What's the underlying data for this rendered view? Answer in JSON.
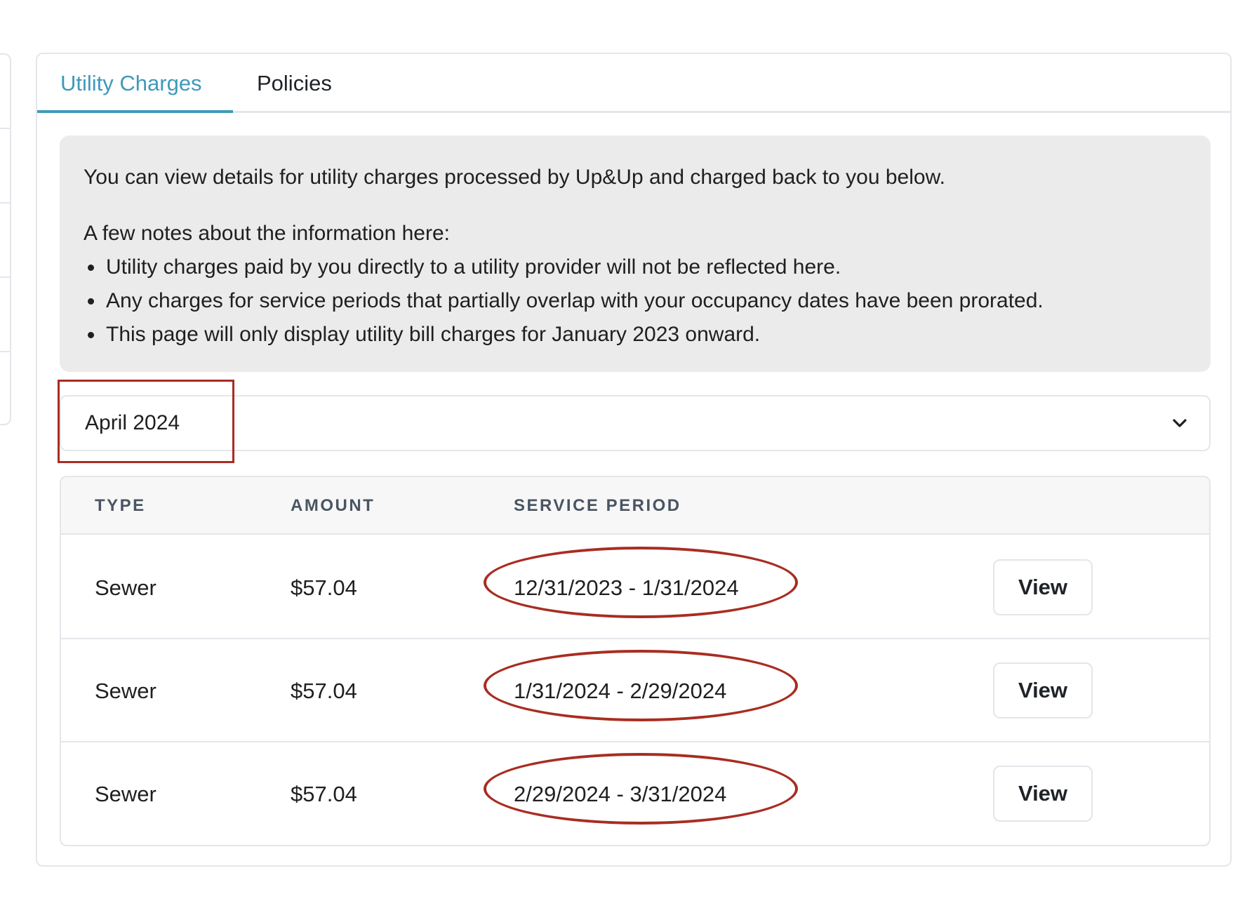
{
  "tabs": [
    {
      "label": "Utility Charges",
      "active": true
    },
    {
      "label": "Policies",
      "active": false
    }
  ],
  "info": {
    "intro": "You can view details for utility charges processed by Up&Up and charged back to you below.",
    "notes_heading": "A few notes about the information here:",
    "notes": [
      "Utility charges paid by you directly to a utility provider will not be reflected here.",
      "Any charges for service periods that partially overlap with your occupancy dates have been prorated.",
      "This page will only display utility bill charges for January 2023 onward."
    ]
  },
  "month_select": {
    "value": "April 2024",
    "icon": "chevron-down-icon"
  },
  "table": {
    "headers": {
      "type": "TYPE",
      "amount": "AMOUNT",
      "period": "SERVICE PERIOD"
    },
    "rows": [
      {
        "type": "Sewer",
        "amount": "$57.04",
        "period": "12/31/2023 - 1/31/2024",
        "action": "View"
      },
      {
        "type": "Sewer",
        "amount": "$57.04",
        "period": "1/31/2024 - 2/29/2024",
        "action": "View"
      },
      {
        "type": "Sewer",
        "amount": "$57.04",
        "period": "2/29/2024 - 3/31/2024",
        "action": "View"
      }
    ]
  },
  "colors": {
    "accent": "#3f9ab9",
    "annotation": "#a82d22",
    "info_bg": "#ebebeb"
  }
}
